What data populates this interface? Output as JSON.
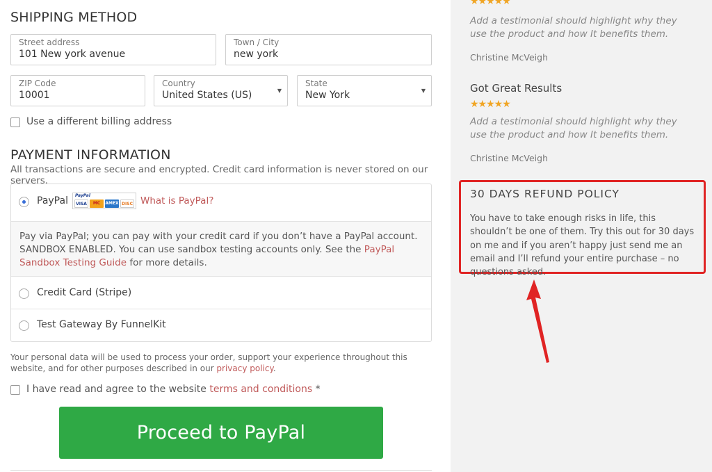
{
  "shipping": {
    "title": "SHIPPING METHOD",
    "street": {
      "label": "Street address",
      "value": "101 New york avenue"
    },
    "city": {
      "label": "Town / City",
      "value": "new york"
    },
    "zip": {
      "label": "ZIP Code",
      "value": "10001"
    },
    "country": {
      "label": "Country",
      "value": "United States (US)"
    },
    "state": {
      "label": "State",
      "value": "New York"
    },
    "billing_checkbox": "Use a different billing address"
  },
  "payment": {
    "title": "PAYMENT INFORMATION",
    "subtitle": "All transactions are secure and encrypted. Credit card information is never stored on our servers.",
    "paypal": {
      "label": "PayPal",
      "what_is_link": "What is PayPal?",
      "mini_logo": "PayPal",
      "cards": [
        "VISA",
        "MC",
        "AMEX",
        "DISC"
      ],
      "desc_before": "Pay via PayPal; you can pay with your credit card if you don’t have a PayPal account. SANDBOX ENABLED. You can use sandbox testing accounts only. See the ",
      "desc_link": "PayPal Sandbox Testing Guide",
      "desc_after": " for more details."
    },
    "options": [
      {
        "label": "Credit Card (Stripe)"
      },
      {
        "label": "Test Gateway By FunnelKit"
      }
    ]
  },
  "privacy": {
    "before": "Your personal data will be used to process your order, support your experience throughout this website, and for other purposes described in our ",
    "link": "privacy policy",
    "after": "."
  },
  "terms": {
    "before": "I have read and agree to the website ",
    "link": "terms and conditions",
    "after": " *"
  },
  "cta": {
    "label": "Proceed to PayPal"
  },
  "sidebar": {
    "testimonials": [
      {
        "title": "",
        "stars": "★★★★★",
        "quote": "Add a testimonial should highlight why they use the product and how It benefits them.",
        "author": "Christine McVeigh"
      },
      {
        "title": "Got Great Results",
        "stars": "★★★★★",
        "quote": "Add a testimonial should highlight why they use the product and how It benefits them.",
        "author": "Christine McVeigh"
      }
    ],
    "refund": {
      "title": "30 DAYS REFUND POLICY",
      "text": "You have to take enough risks in life, this shouldn’t be one of them. Try this out for 30 days on me and if you aren’t happy just send me an email and I’ll refund your entire purchase – no questions asked."
    }
  },
  "colors": {
    "cta": "#2fa945",
    "link": "#c05a5a",
    "star": "#f0a524",
    "highlight": "#e02424"
  }
}
